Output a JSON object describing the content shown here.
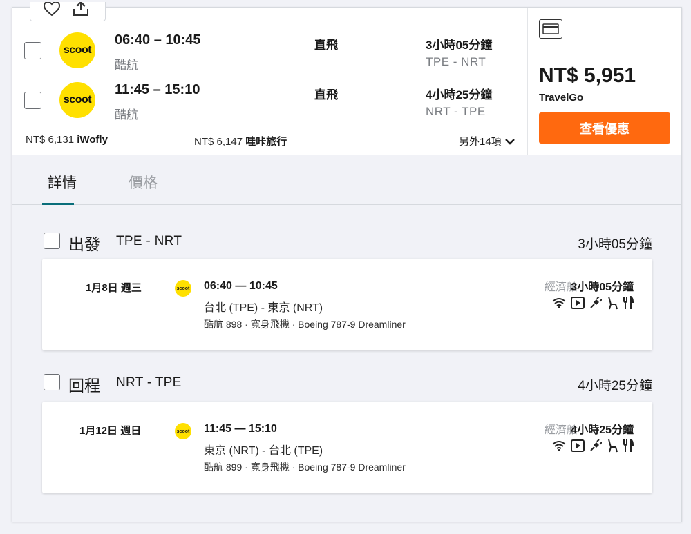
{
  "options": [
    {
      "logo_text": "scoot",
      "times": "06:40 – 10:45",
      "airline": "酷航",
      "stops": "直飛",
      "duration": "3小時05分鐘",
      "route": "TPE - NRT"
    },
    {
      "logo_text": "scoot",
      "times": "11:45 – 15:10",
      "airline": "酷航",
      "stops": "直飛",
      "duration": "4小時25分鐘",
      "route": "NRT - TPE"
    }
  ],
  "alt_prices": [
    {
      "price": "NT$ 6,131",
      "source": "iWofly"
    },
    {
      "price": "NT$ 6,147",
      "source": "哇咔旅行"
    }
  ],
  "more_label": "另外14項",
  "price_panel": {
    "price": "NT$ 5,951",
    "vendor": "TravelGo",
    "button_label": "查看優惠"
  },
  "tabs": {
    "details": "詳情",
    "price": "價格"
  },
  "legs": [
    {
      "title": "出發",
      "route": "TPE - NRT",
      "duration": "3小時05分鐘",
      "segment": {
        "date": "1月8日 週三",
        "logo_text": "scoot",
        "times": "06:40 — 10:45",
        "route": "台北 (TPE) - 東京 (NRT)",
        "flight_no": "酷航 898",
        "aircraft_type": "寬身飛機",
        "aircraft": "Boeing 787-9 Dreamliner",
        "cabin": "經濟艙",
        "duration": "3小時05分鐘"
      }
    },
    {
      "title": "回程",
      "route": "NRT - TPE",
      "duration": "4小時25分鐘",
      "segment": {
        "date": "1月12日 週日",
        "logo_text": "scoot",
        "times": "11:45 — 15:10",
        "route": "東京 (NRT) - 台北 (TPE)",
        "flight_no": "酷航 899",
        "aircraft_type": "寬身飛機",
        "aircraft": "Boeing 787-9 Dreamliner",
        "cabin": "經濟艙",
        "duration": "4小時25分鐘"
      }
    }
  ],
  "separator": " · ",
  "amenity_icons": [
    "wifi-icon",
    "video-icon",
    "power-icon",
    "seat-icon",
    "meal-icon"
  ],
  "colors": {
    "accent_orange": "#ff690f",
    "scoot_yellow": "#ffe000",
    "tab_underline": "#0a6e7a"
  }
}
